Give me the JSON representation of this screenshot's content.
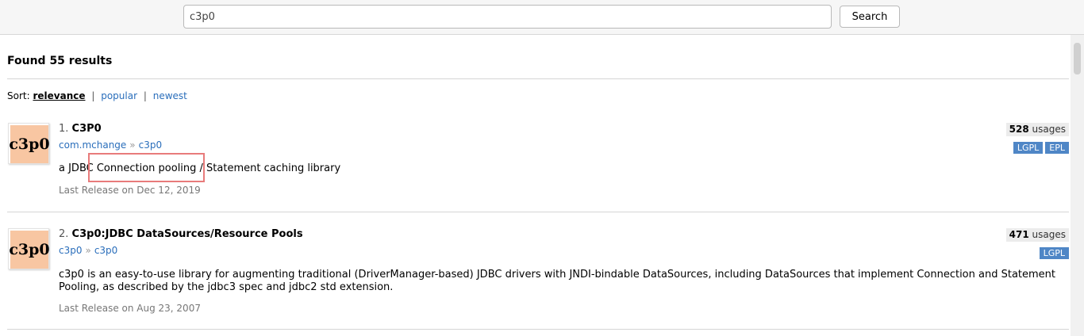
{
  "search": {
    "query": "c3p0",
    "button_label": "Search"
  },
  "results_header": {
    "title": "Found 55 results"
  },
  "sort": {
    "label": "Sort:",
    "options": [
      "relevance",
      "popular",
      "newest"
    ],
    "separator": "|",
    "active": "relevance"
  },
  "results": [
    {
      "number": "1.",
      "name": "C3P0",
      "logo_text": "c3p0",
      "group": "com.mchange",
      "separator": "»",
      "artifact": "c3p0",
      "description": "a JDBC Connection pooling / Statement caching library",
      "last_release": "Last Release on Dec 12, 2019",
      "usages_count": "528",
      "usages_label": "usages",
      "licenses": [
        "LGPL",
        "EPL"
      ]
    },
    {
      "number": "2.",
      "name": "C3p0:JDBC DataSources/Resource Pools",
      "logo_text": "c3p0",
      "group": "c3p0",
      "separator": "»",
      "artifact": "c3p0",
      "description": "c3p0 is an easy-to-use library for augmenting traditional (DriverManager-based) JDBC drivers with JNDI-bindable DataSources, including DataSources that implement Connection and Statement Pooling, as described by the jdbc3 spec and jdbc2 std extension.",
      "last_release": "Last Release on Aug 23, 2007",
      "usages_count": "471",
      "usages_label": "usages",
      "licenses": [
        "LGPL"
      ]
    }
  ],
  "colors": {
    "link": "#2a6ebb",
    "license_badge": "#4f86c6",
    "logo_bg": "#f8c6a2",
    "highlight": "#e87b7b"
  }
}
